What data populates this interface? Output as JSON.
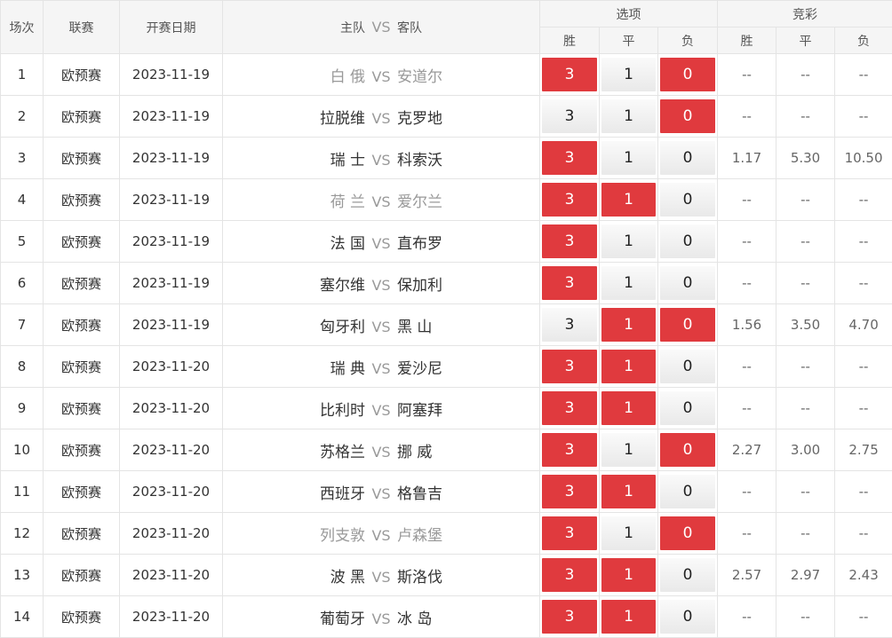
{
  "headers": {
    "num": "场次",
    "league": "联赛",
    "date": "开赛日期",
    "home": "主队",
    "vs": "VS",
    "away": "客队",
    "options": "选项",
    "jingcai": "竞彩",
    "win": "胜",
    "draw": "平",
    "lose": "负"
  },
  "colors": {
    "selected": "#e03a3e",
    "header_bg": "#f5f5f5"
  },
  "rows": [
    {
      "num": "1",
      "league": "欧预赛",
      "date": "2023-11-19",
      "home": "白 俄",
      "away": "安道尔",
      "muted": true,
      "opts": [
        "3",
        "1",
        "0"
      ],
      "sel": [
        true,
        false,
        true
      ],
      "odds": [
        "--",
        "--",
        "--"
      ]
    },
    {
      "num": "2",
      "league": "欧预赛",
      "date": "2023-11-19",
      "home": "拉脱维",
      "away": "克罗地",
      "muted": false,
      "opts": [
        "3",
        "1",
        "0"
      ],
      "sel": [
        false,
        false,
        true
      ],
      "odds": [
        "--",
        "--",
        "--"
      ]
    },
    {
      "num": "3",
      "league": "欧预赛",
      "date": "2023-11-19",
      "home": "瑞 士",
      "away": "科索沃",
      "muted": false,
      "opts": [
        "3",
        "1",
        "0"
      ],
      "sel": [
        true,
        false,
        false
      ],
      "odds": [
        "1.17",
        "5.30",
        "10.50"
      ]
    },
    {
      "num": "4",
      "league": "欧预赛",
      "date": "2023-11-19",
      "home": "荷 兰",
      "away": "爱尔兰",
      "muted": true,
      "opts": [
        "3",
        "1",
        "0"
      ],
      "sel": [
        true,
        true,
        false
      ],
      "odds": [
        "--",
        "--",
        "--"
      ]
    },
    {
      "num": "5",
      "league": "欧预赛",
      "date": "2023-11-19",
      "home": "法 国",
      "away": "直布罗",
      "muted": false,
      "opts": [
        "3",
        "1",
        "0"
      ],
      "sel": [
        true,
        false,
        false
      ],
      "odds": [
        "--",
        "--",
        "--"
      ]
    },
    {
      "num": "6",
      "league": "欧预赛",
      "date": "2023-11-19",
      "home": "塞尔维",
      "away": "保加利",
      "muted": false,
      "opts": [
        "3",
        "1",
        "0"
      ],
      "sel": [
        true,
        false,
        false
      ],
      "odds": [
        "--",
        "--",
        "--"
      ]
    },
    {
      "num": "7",
      "league": "欧预赛",
      "date": "2023-11-19",
      "home": "匈牙利",
      "away": "黑 山",
      "muted": false,
      "opts": [
        "3",
        "1",
        "0"
      ],
      "sel": [
        false,
        true,
        true
      ],
      "odds": [
        "1.56",
        "3.50",
        "4.70"
      ]
    },
    {
      "num": "8",
      "league": "欧预赛",
      "date": "2023-11-20",
      "home": "瑞 典",
      "away": "爱沙尼",
      "muted": false,
      "opts": [
        "3",
        "1",
        "0"
      ],
      "sel": [
        true,
        true,
        false
      ],
      "odds": [
        "--",
        "--",
        "--"
      ]
    },
    {
      "num": "9",
      "league": "欧预赛",
      "date": "2023-11-20",
      "home": "比利时",
      "away": "阿塞拜",
      "muted": false,
      "opts": [
        "3",
        "1",
        "0"
      ],
      "sel": [
        true,
        true,
        false
      ],
      "odds": [
        "--",
        "--",
        "--"
      ]
    },
    {
      "num": "10",
      "league": "欧预赛",
      "date": "2023-11-20",
      "home": "苏格兰",
      "away": "挪 威",
      "muted": false,
      "opts": [
        "3",
        "1",
        "0"
      ],
      "sel": [
        true,
        false,
        true
      ],
      "odds": [
        "2.27",
        "3.00",
        "2.75"
      ]
    },
    {
      "num": "11",
      "league": "欧预赛",
      "date": "2023-11-20",
      "home": "西班牙",
      "away": "格鲁吉",
      "muted": false,
      "opts": [
        "3",
        "1",
        "0"
      ],
      "sel": [
        true,
        true,
        false
      ],
      "odds": [
        "--",
        "--",
        "--"
      ]
    },
    {
      "num": "12",
      "league": "欧预赛",
      "date": "2023-11-20",
      "home": "列支敦",
      "away": "卢森堡",
      "muted": true,
      "opts": [
        "3",
        "1",
        "0"
      ],
      "sel": [
        true,
        false,
        true
      ],
      "odds": [
        "--",
        "--",
        "--"
      ]
    },
    {
      "num": "13",
      "league": "欧预赛",
      "date": "2023-11-20",
      "home": "波 黑",
      "away": "斯洛伐",
      "muted": false,
      "opts": [
        "3",
        "1",
        "0"
      ],
      "sel": [
        true,
        true,
        false
      ],
      "odds": [
        "2.57",
        "2.97",
        "2.43"
      ]
    },
    {
      "num": "14",
      "league": "欧预赛",
      "date": "2023-11-20",
      "home": "葡萄牙",
      "away": "冰 岛",
      "muted": false,
      "opts": [
        "3",
        "1",
        "0"
      ],
      "sel": [
        true,
        true,
        false
      ],
      "odds": [
        "--",
        "--",
        "--"
      ]
    }
  ]
}
